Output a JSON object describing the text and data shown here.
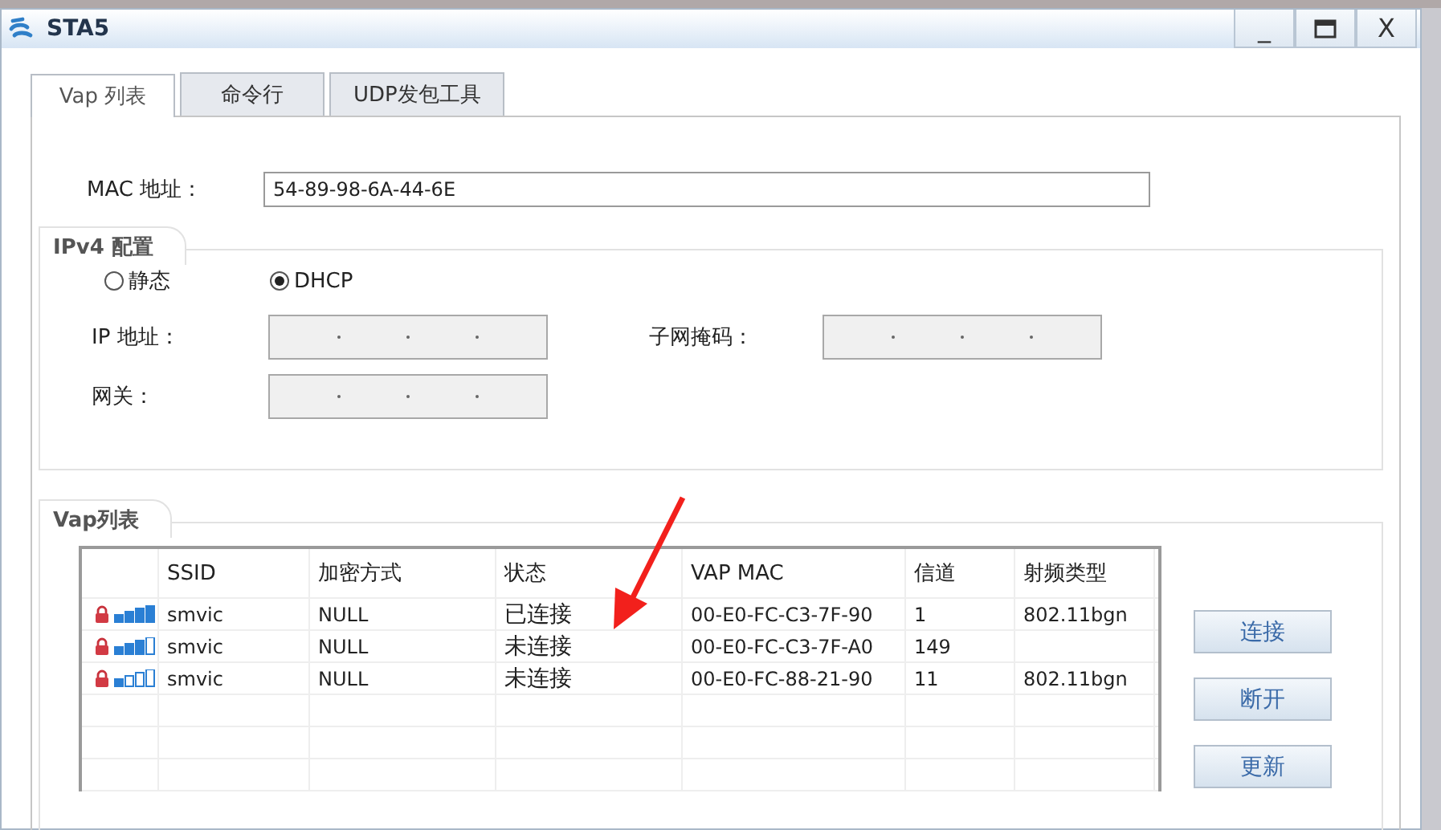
{
  "window": {
    "title": "STA5",
    "controls": [
      "_",
      "X"
    ]
  },
  "tabs": [
    {
      "label": "Vap 列表",
      "selected": true
    },
    {
      "label": "命令行",
      "selected": false
    },
    {
      "label": "UDP发包工具",
      "selected": false
    }
  ],
  "mac": {
    "label": "MAC 地址：",
    "value": "54-89-98-6A-44-6E"
  },
  "ipv4": {
    "title": "IPv4 配置",
    "modes": [
      {
        "label": "静态",
        "selected": false
      },
      {
        "label": "DHCP",
        "selected": true
      }
    ],
    "ip_label": "IP 地址：",
    "mask_label": "子网掩码：",
    "gateway_label": "网关："
  },
  "vap": {
    "title": "Vap列表",
    "columns": [
      "SSID",
      "加密方式",
      "状态",
      "VAP MAC",
      "信道",
      "射频类型"
    ],
    "rows": [
      {
        "locked": true,
        "kind": "strong",
        "ssid": "smvic",
        "encryption": "NULL",
        "status": "已连接",
        "vap_mac": "00-E0-FC-C3-7F-90",
        "channel": "1",
        "radio": "802.11bgn"
      },
      {
        "locked": true,
        "kind": "medium",
        "ssid": "smvic",
        "encryption": "NULL",
        "status": "未连接",
        "vap_mac": "00-E0-FC-C3-7F-A0",
        "channel": "149"
      },
      {
        "locked": true,
        "kind": "weak",
        "ssid": "smvic",
        "encryption": "NULL",
        "status": "未连接",
        "vap_mac": "00-E0-FC-88-21-90",
        "channel": "11",
        "radio": "802.11bgn"
      }
    ],
    "buttons": [
      "连接",
      "断开",
      "更新"
    ]
  }
}
